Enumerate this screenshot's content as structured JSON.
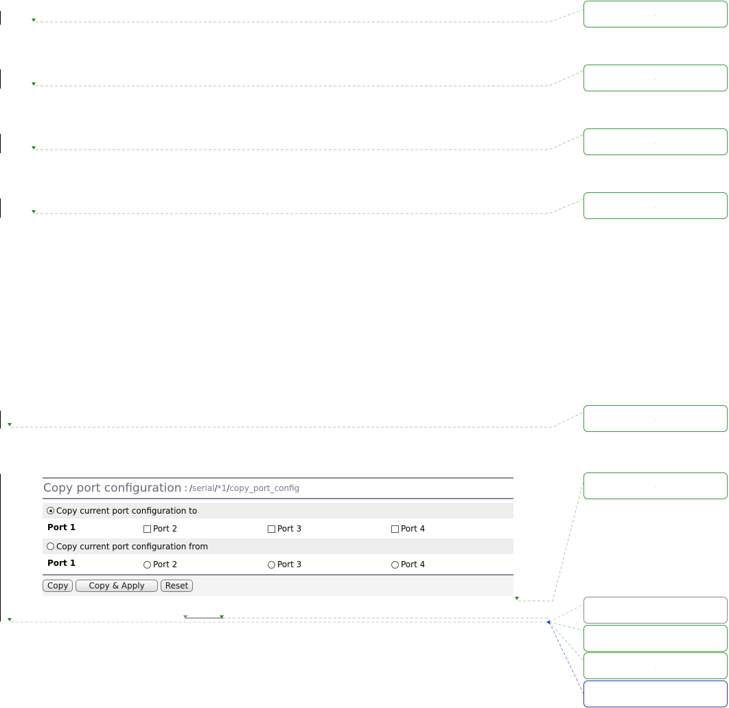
{
  "panel": {
    "title": "Copy port configuration",
    "separator": ":",
    "path_parts": [
      "/",
      "serial",
      "/",
      "*1",
      "/",
      "copy_port_config"
    ],
    "option_to": {
      "label": "Copy current port configuration to",
      "selected": true
    },
    "to_row": {
      "source_label": "Port 1",
      "targets": [
        "Port 2",
        "Port 3",
        "Port 4"
      ]
    },
    "option_from": {
      "label": "Copy current port configuration from",
      "selected": false
    },
    "from_row": {
      "target_label": "Port 1",
      "sources": [
        "Port 2",
        "Port 3",
        "Port 4"
      ]
    },
    "buttons": {
      "copy": "Copy",
      "copy_apply": "Copy & Apply",
      "reset": "Reset"
    }
  },
  "bubbles": [
    ".",
    ".",
    ".",
    ".",
    ".",
    ".",
    "",
    "",
    ".",
    ""
  ],
  "colors": {
    "accent_green": "#3a9a3a",
    "link_blue": "#3030c0",
    "rule_gray": "#8a8a98"
  }
}
